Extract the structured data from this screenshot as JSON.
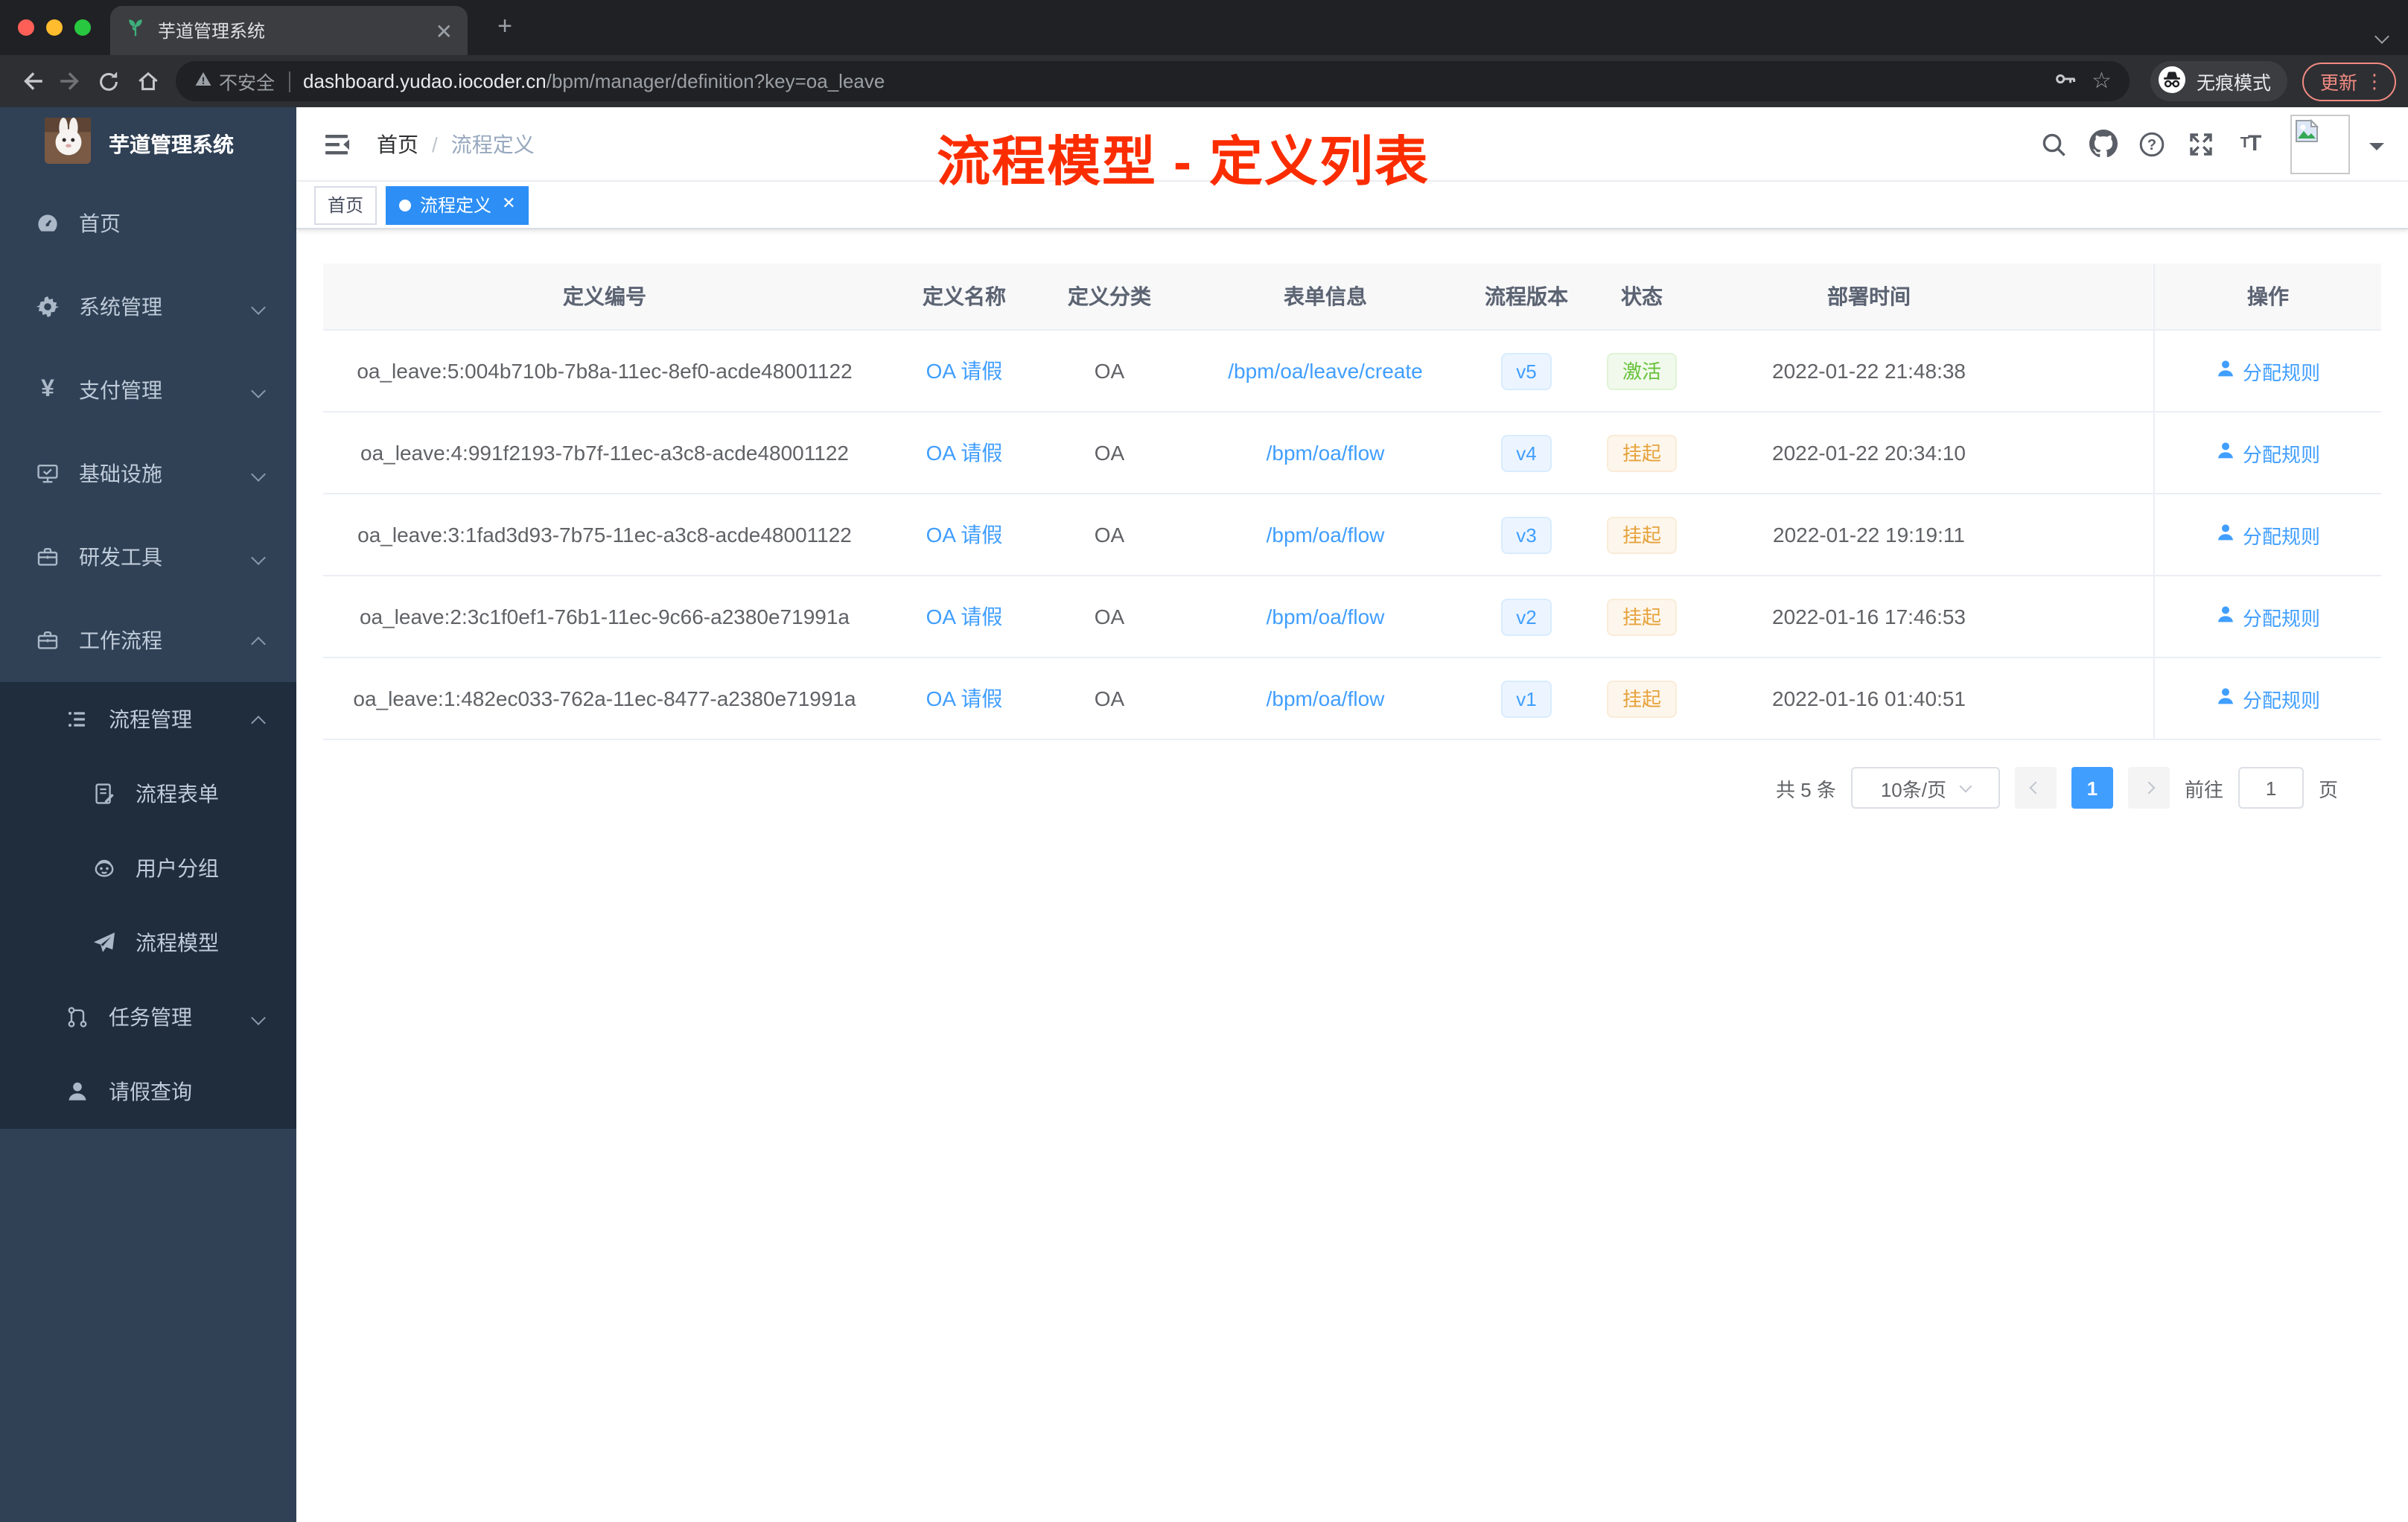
{
  "browser": {
    "tab_title": "芋道管理系统",
    "new_tab_label": "+",
    "security_label": "不安全",
    "url_host": "dashboard.yudao.iocoder.cn",
    "url_path": "/bpm/manager/definition?key=oa_leave",
    "incognito_label": "无痕模式",
    "update_label": "更新",
    "menu_dots": "⋮",
    "close_glyph": "✕",
    "star_glyph": "☆"
  },
  "sidebar": {
    "logo_title": "芋道管理系统",
    "items": [
      {
        "key": "home",
        "label": "首页",
        "icon": "dashboard",
        "level": 1
      },
      {
        "key": "system-management",
        "label": "系统管理",
        "icon": "gear",
        "level": 1,
        "arrow": "down"
      },
      {
        "key": "payment-management",
        "label": "支付管理",
        "icon": "yen",
        "level": 1,
        "arrow": "down"
      },
      {
        "key": "infrastructure",
        "label": "基础设施",
        "icon": "monitor",
        "level": 1,
        "arrow": "down"
      },
      {
        "key": "dev-tools",
        "label": "研发工具",
        "icon": "toolbox",
        "level": 1,
        "arrow": "down"
      },
      {
        "key": "workflow",
        "label": "工作流程",
        "icon": "toolbox",
        "level": 1,
        "arrow": "up"
      },
      {
        "key": "process-management",
        "label": "流程管理",
        "icon": "list",
        "level": 2,
        "arrow": "up",
        "dark": true
      },
      {
        "key": "process-form",
        "label": "流程表单",
        "icon": "form",
        "level": 3,
        "dark": true
      },
      {
        "key": "user-group",
        "label": "用户分组",
        "icon": "people",
        "level": 3,
        "dark": true
      },
      {
        "key": "process-model",
        "label": "流程模型",
        "icon": "send",
        "level": 3,
        "dark": true
      },
      {
        "key": "task-management",
        "label": "任务管理",
        "icon": "tree",
        "level": 2,
        "arrow": "down",
        "dark": true
      },
      {
        "key": "leave-query",
        "label": "请假查询",
        "icon": "user",
        "level": 2,
        "dark": true
      }
    ]
  },
  "navbar": {
    "breadcrumb": {
      "home": "首页",
      "separator": "/",
      "current": "流程定义"
    }
  },
  "annotation": {
    "text": "流程模型 - 定义列表",
    "color": "#fb2d00"
  },
  "tags": [
    {
      "key": "home",
      "label": "首页",
      "active": false,
      "closable": false
    },
    {
      "key": "process-definition",
      "label": "流程定义",
      "active": true,
      "closable": true
    }
  ],
  "table": {
    "columns": [
      {
        "key": "id",
        "label": "定义编号"
      },
      {
        "key": "name",
        "label": "定义名称"
      },
      {
        "key": "category",
        "label": "定义分类"
      },
      {
        "key": "form",
        "label": "表单信息"
      },
      {
        "key": "version",
        "label": "流程版本"
      },
      {
        "key": "status",
        "label": "状态"
      },
      {
        "key": "time",
        "label": "部署时间"
      },
      {
        "key": "actions",
        "label": "操作"
      }
    ],
    "action_label": "分配规则",
    "rows": [
      {
        "id": "oa_leave:5:004b710b-7b8a-11ec-8ef0-acde48001122",
        "name": "OA 请假",
        "category": "OA",
        "form": "/bpm/oa/leave/create",
        "version": "v5",
        "status": "激活",
        "status_type": "success",
        "deploy_time": "2022-01-22 21:48:38"
      },
      {
        "id": "oa_leave:4:991f2193-7b7f-11ec-a3c8-acde48001122",
        "name": "OA 请假",
        "category": "OA",
        "form": "/bpm/oa/flow",
        "version": "v4",
        "status": "挂起",
        "status_type": "warning",
        "deploy_time": "2022-01-22 20:34:10"
      },
      {
        "id": "oa_leave:3:1fad3d93-7b75-11ec-a3c8-acde48001122",
        "name": "OA 请假",
        "category": "OA",
        "form": "/bpm/oa/flow",
        "version": "v3",
        "status": "挂起",
        "status_type": "warning",
        "deploy_time": "2022-01-22 19:19:11"
      },
      {
        "id": "oa_leave:2:3c1f0ef1-76b1-11ec-9c66-a2380e71991a",
        "name": "OA 请假",
        "category": "OA",
        "form": "/bpm/oa/flow",
        "version": "v2",
        "status": "挂起",
        "status_type": "warning",
        "deploy_time": "2022-01-16 17:46:53"
      },
      {
        "id": "oa_leave:1:482ec033-762a-11ec-8477-a2380e71991a",
        "name": "OA 请假",
        "category": "OA",
        "form": "/bpm/oa/flow",
        "version": "v1",
        "status": "挂起",
        "status_type": "warning",
        "deploy_time": "2022-01-16 01:40:51"
      }
    ]
  },
  "pagination": {
    "total": "共 5 条",
    "page_size": "10条/页",
    "current_page": "1",
    "goto_label": "前往",
    "goto_value": "1",
    "page_unit": "页"
  },
  "colors": {
    "primary": "#409eff",
    "success": "#67c23a",
    "warning": "#e6a23c",
    "annotation_red": "#fb2d00",
    "sidebar_bg": "#304156",
    "sidebar_submenu_bg": "#1f2d3d",
    "active_tag_bg": "#2d8ff5"
  }
}
